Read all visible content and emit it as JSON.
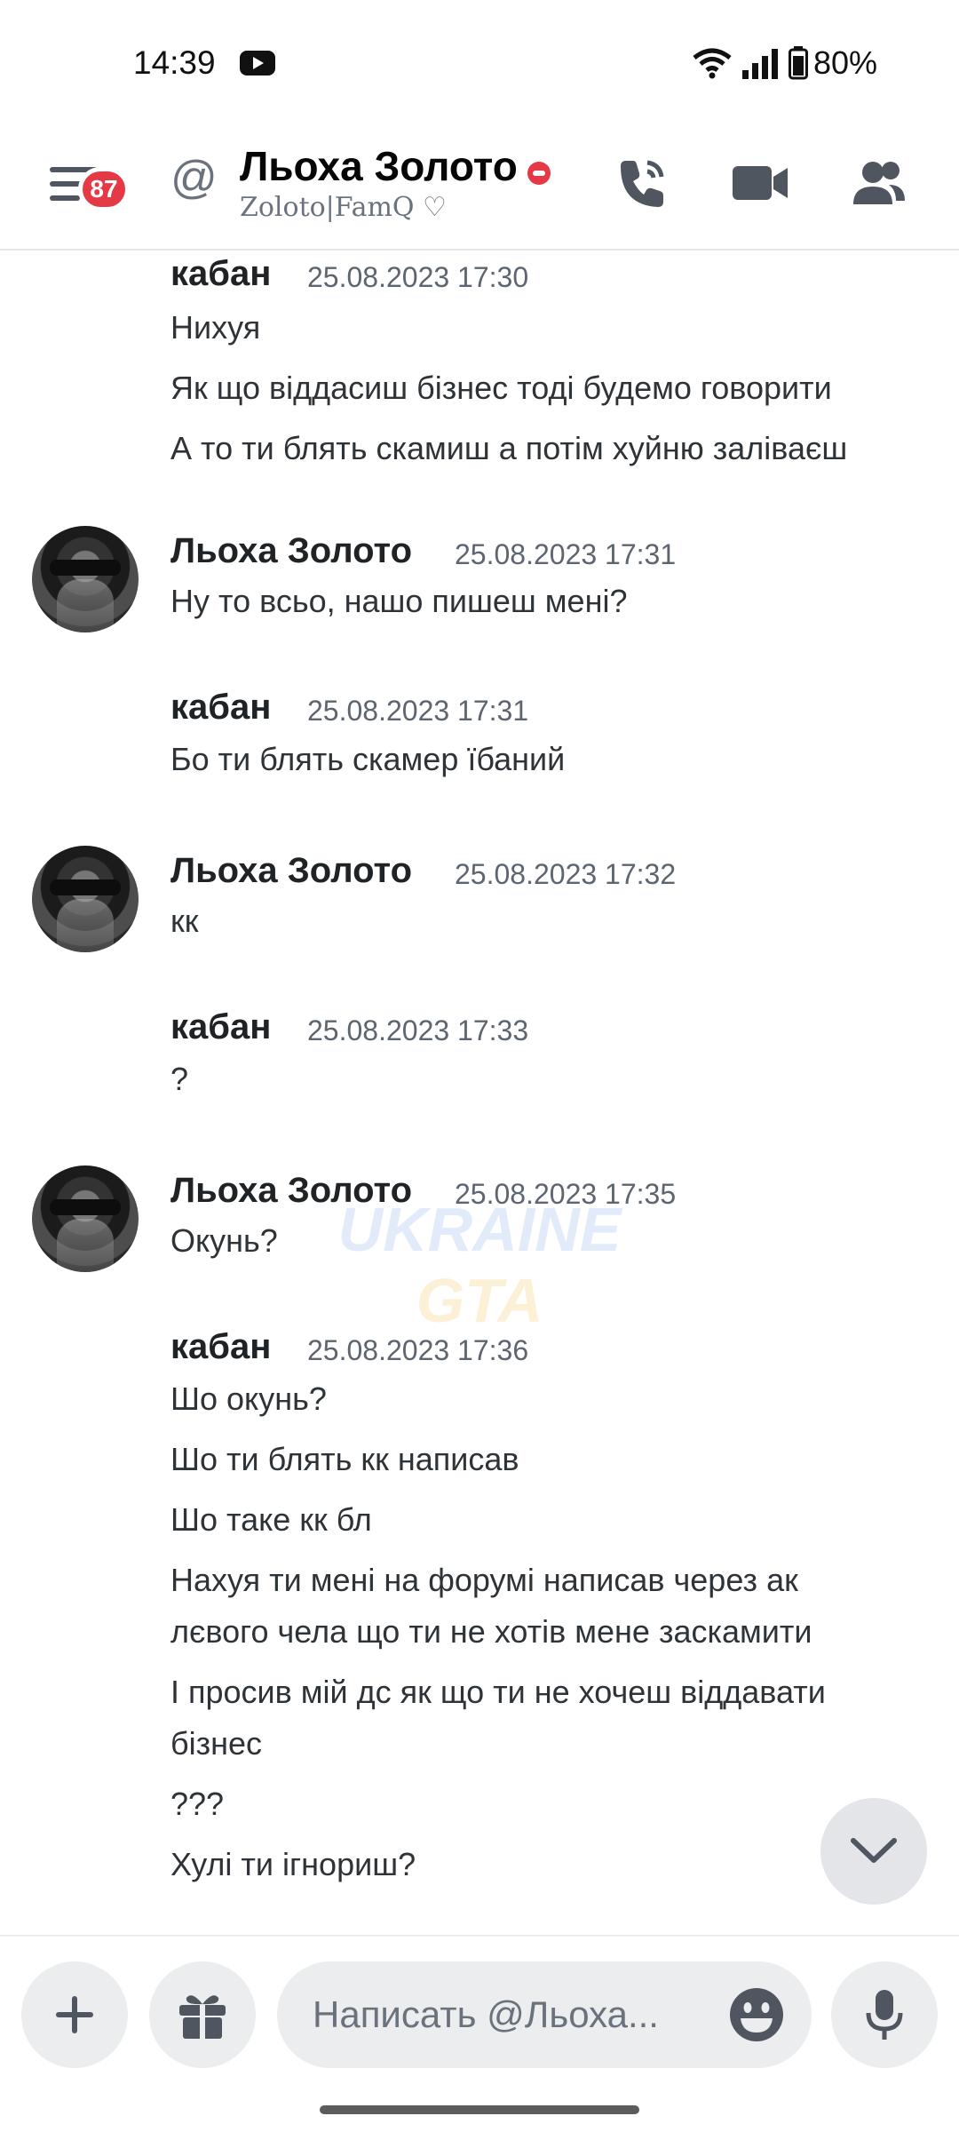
{
  "status_bar": {
    "time": "14:39",
    "battery": "80%"
  },
  "header": {
    "badge_count": "87",
    "at_sign": "@",
    "name": "Льоха Золото",
    "subtitle": "Zoloto|FamQ ♡"
  },
  "messages": [
    {
      "author": "кабан",
      "timestamp": "25.08.2023 17:30",
      "lines": [
        "Нихуя",
        "Як що віддасиш бізнес тоді будемо говорити",
        "А то ти блять скамиш а потім хуйню заліваєш"
      ]
    },
    {
      "author": "Льоха Золото",
      "timestamp": "25.08.2023 17:31",
      "lines": [
        "Ну то всьо, нашо пишеш мені?"
      ]
    },
    {
      "author": "кабан",
      "timestamp": "25.08.2023 17:31",
      "lines": [
        "Бо ти блять скамер їбаний"
      ]
    },
    {
      "author": "Льоха Золото",
      "timestamp": "25.08.2023 17:32",
      "lines": [
        "кк"
      ]
    },
    {
      "author": "кабан",
      "timestamp": "25.08.2023 17:33",
      "lines": [
        "?"
      ]
    },
    {
      "author": "Льоха Золото",
      "timestamp": "25.08.2023 17:35",
      "lines": [
        "Окунь?"
      ]
    },
    {
      "author": "кабан",
      "timestamp": "25.08.2023 17:36",
      "lines": [
        "Шо окунь?",
        "Шо ти блять кк написав",
        "Шо таке кк бл",
        "Нахуя ти мені на форумі написав через ак",
        "лєвого чела що ти не хотів мене заскамити",
        "І просив мій дс як що ти не хочеш віддавати",
        "бізнес",
        "???",
        "Хулі ти ігнориш?"
      ]
    }
  ],
  "watermark": {
    "line1": "UKRAINE",
    "line2": "GTA"
  },
  "composer": {
    "placeholder": "Написать @Льоха..."
  },
  "icons": {
    "menu": "hamburger-icon",
    "call": "phone-call-icon",
    "video": "video-camera-icon",
    "members": "members-icon",
    "add": "plus-icon",
    "gift": "gift-icon",
    "emoji": "emoji-icon",
    "mic": "microphone-icon",
    "scroll": "chevron-down-icon"
  },
  "colors": {
    "badge": "#e53945",
    "dnd": "#e53945",
    "text": "#2e3338",
    "muted": "#5c6570"
  }
}
